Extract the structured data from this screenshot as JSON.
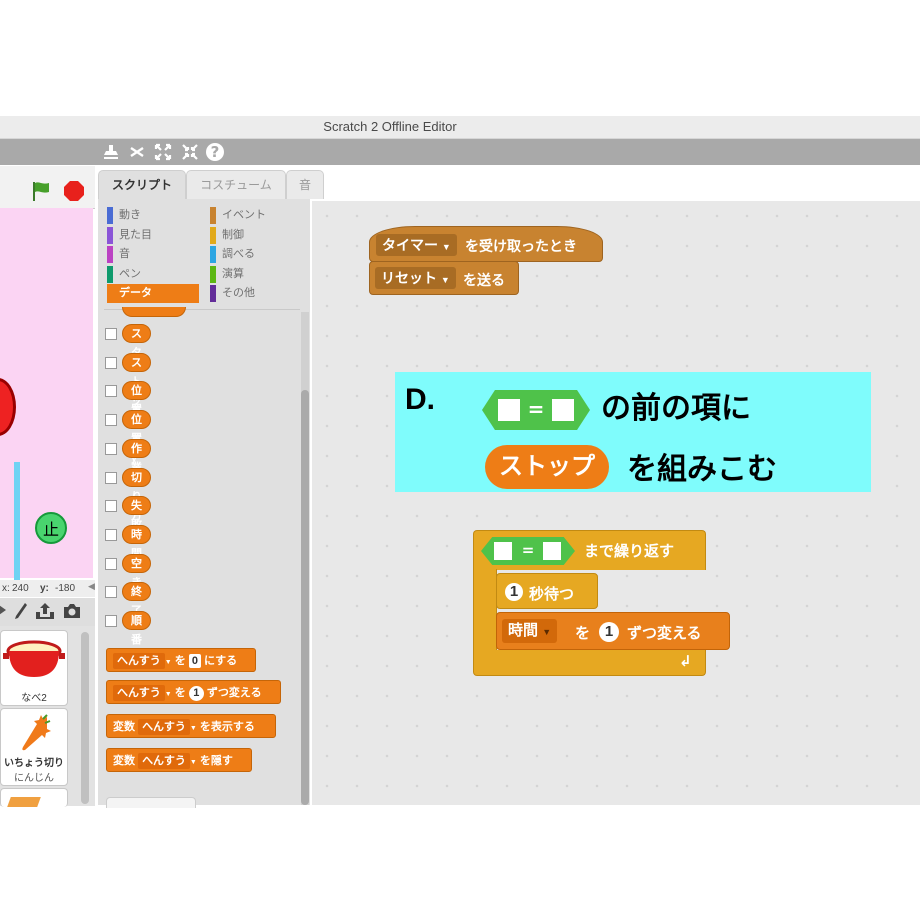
{
  "window": {
    "title": "Scratch 2 Offline Editor"
  },
  "toolbar": {
    "icons": [
      "stamp-icon",
      "cut-icon",
      "grow-icon",
      "shrink-icon",
      "help-icon"
    ],
    "help_glyph": "?"
  },
  "stage": {
    "stop_sprite_label": "止",
    "coords": {
      "x_label": "x:",
      "x_value": "240",
      "y_label": "y:",
      "y_value": "-180"
    }
  },
  "sprites": [
    {
      "name": "なべ2"
    },
    {
      "name": "いちょう切り",
      "sub": "にんじん"
    }
  ],
  "tabs": [
    "スクリプト",
    "コスチューム",
    "音"
  ],
  "categories": {
    "left": [
      {
        "label": "動き",
        "color": "#4a6cd4"
      },
      {
        "label": "見た目",
        "color": "#8a55d7"
      },
      {
        "label": "音",
        "color": "#bb42c3"
      },
      {
        "label": "ペン",
        "color": "#0e9a6c"
      },
      {
        "label": "データ",
        "color": "#ee7d16"
      }
    ],
    "right": [
      {
        "label": "イベント",
        "color": "#c88330"
      },
      {
        "label": "制御",
        "color": "#e1a91a"
      },
      {
        "label": "調べる",
        "color": "#2ca5e2"
      },
      {
        "label": "演算",
        "color": "#5cb712"
      },
      {
        "label": "その他",
        "color": "#632d99"
      }
    ]
  },
  "variables": [
    "スタート",
    "ストップ",
    "位置",
    "位置y",
    "作業",
    "切り方",
    "失敗",
    "時間",
    "空き",
    "終了",
    "順番"
  ],
  "palette_blocks": {
    "set": {
      "var": "へんすう",
      "to": "を",
      "value": "0",
      "suffix": "にする"
    },
    "change": {
      "var": "へんすう",
      "by": "を",
      "value": "1",
      "suffix": "ずつ変える"
    },
    "show": {
      "prefix": "変数",
      "var": "へんすう",
      "suffix": "を表示する"
    },
    "hide": {
      "prefix": "変数",
      "var": "へんすう",
      "suffix": "を隠す"
    }
  },
  "scripts": {
    "hat": {
      "dropdown": "タイマー",
      "suffix": "を受け取ったとき"
    },
    "broadcast": {
      "dropdown": "リセット",
      "suffix": "を送る"
    },
    "repeat_until": {
      "eq": "=",
      "label": "まで繰り返す"
    },
    "wait": {
      "value": "1",
      "label": "秒待つ"
    },
    "change": {
      "var": "時間",
      "by": "を",
      "value": "1",
      "suffix": "ずつ変える"
    }
  },
  "annotation": {
    "letter": "D.",
    "line1_suffix": "の前の項に",
    "eq": "=",
    "reporter": "ストップ",
    "line2_suffix": "を組みこむ",
    "bg_color": "#7ffcfc"
  }
}
